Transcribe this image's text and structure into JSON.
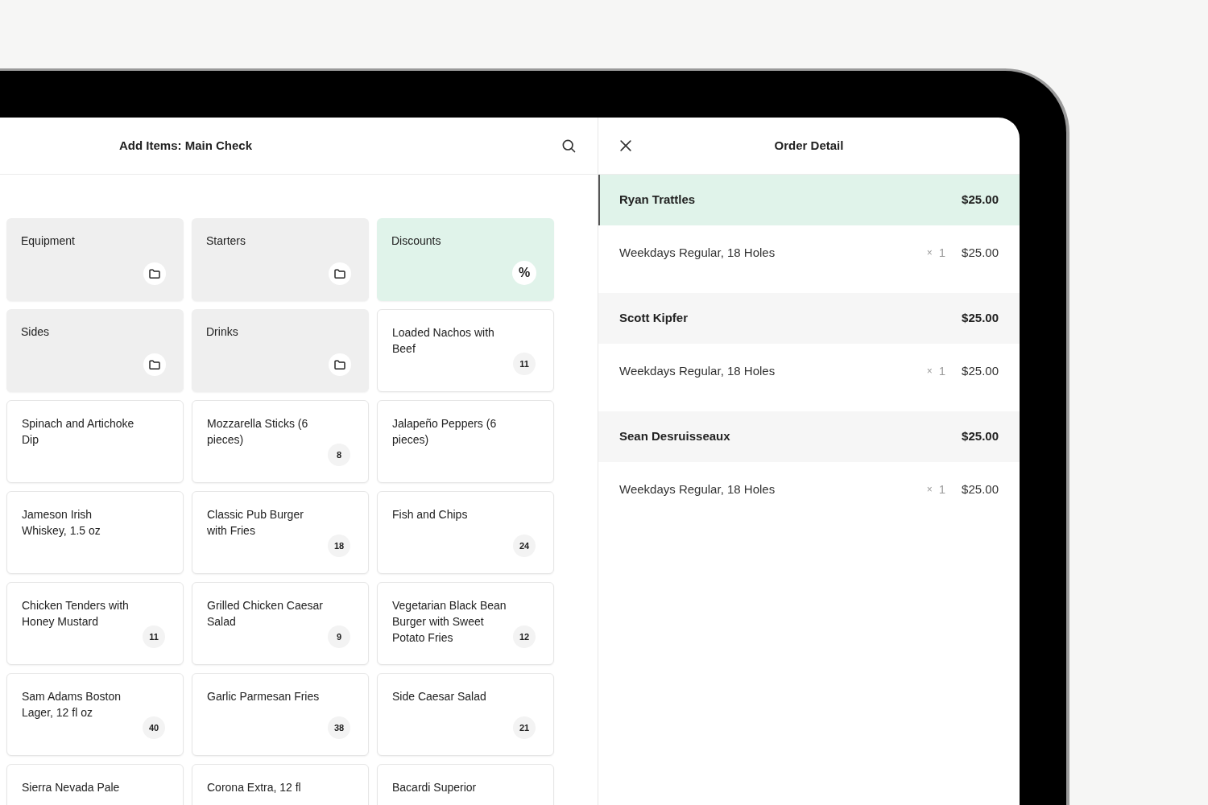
{
  "add_items": {
    "title": "Add Items: Main Check",
    "tiles": [
      {
        "kind": "folder",
        "label": "Equipment"
      },
      {
        "kind": "folder",
        "label": "Starters"
      },
      {
        "kind": "discount",
        "label": "Discounts",
        "symbol": "%"
      },
      {
        "kind": "folder",
        "label": "Sides"
      },
      {
        "kind": "folder",
        "label": "Drinks"
      },
      {
        "kind": "item",
        "label": "Loaded Nachos with Beef",
        "count": "11"
      },
      {
        "kind": "item",
        "label": "Spinach and Artichoke Dip"
      },
      {
        "kind": "item",
        "label": "Mozzarella Sticks (6 pieces)",
        "count": "8"
      },
      {
        "kind": "item",
        "label": "Jalapeño Peppers (6 pieces)"
      },
      {
        "kind": "item",
        "label": "Jameson Irish Whiskey, 1.5 oz"
      },
      {
        "kind": "item",
        "label": "Classic Pub Burger with Fries",
        "count": "18"
      },
      {
        "kind": "item",
        "label": "Fish and Chips",
        "count": "24"
      },
      {
        "kind": "item",
        "label": "Chicken Tenders with Honey Mustard",
        "count": "11"
      },
      {
        "kind": "item",
        "label": "Grilled Chicken Caesar Salad",
        "count": "9"
      },
      {
        "kind": "item",
        "label": "Vegetarian Black Bean Burger with Sweet Potato Fries",
        "count": "12"
      },
      {
        "kind": "item",
        "label": "Sam Adams Boston Lager, 12 fl oz",
        "count": "40"
      },
      {
        "kind": "item",
        "label": "Garlic Parmesan Fries",
        "count": "38"
      },
      {
        "kind": "item",
        "label": "Side Caesar Salad",
        "count": "21"
      },
      {
        "kind": "item",
        "label": "Sierra Nevada Pale"
      },
      {
        "kind": "item",
        "label": "Corona Extra, 12 fl"
      },
      {
        "kind": "item",
        "label": "Bacardi Superior"
      }
    ]
  },
  "order_detail": {
    "title": "Order Detail",
    "guests": [
      {
        "name": "Ryan Trattles",
        "total": "$25.00",
        "selected": true,
        "items": [
          {
            "name": "Weekdays Regular, 18 Holes",
            "multiplier": "×",
            "quantity": "1",
            "price": "$25.00"
          }
        ]
      },
      {
        "name": "Scott Kipfer",
        "total": "$25.00",
        "selected": false,
        "items": [
          {
            "name": "Weekdays Regular, 18 Holes",
            "multiplier": "×",
            "quantity": "1",
            "price": "$25.00"
          }
        ]
      },
      {
        "name": "Sean Desruisseaux",
        "total": "$25.00",
        "selected": false,
        "items": [
          {
            "name": "Weekdays Regular, 18 Holes",
            "multiplier": "×",
            "quantity": "1",
            "price": "$25.00"
          }
        ]
      }
    ]
  }
}
